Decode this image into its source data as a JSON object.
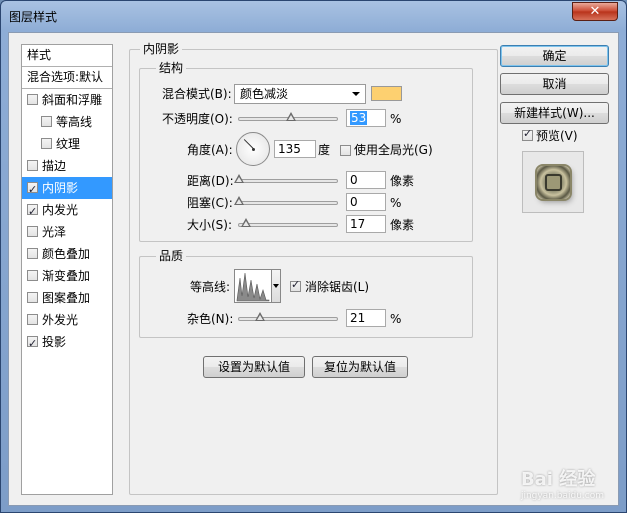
{
  "window": {
    "title": "图层样式",
    "close_glyph": "✕"
  },
  "sidebar": {
    "header": "样式",
    "blend_options": "混合选项:默认",
    "items": [
      {
        "label": "斜面和浮雕",
        "checked": false,
        "sub": false,
        "selected": false
      },
      {
        "label": "等高线",
        "checked": false,
        "sub": true,
        "selected": false
      },
      {
        "label": "纹理",
        "checked": false,
        "sub": true,
        "selected": false
      },
      {
        "label": "描边",
        "checked": false,
        "sub": false,
        "selected": false
      },
      {
        "label": "内阴影",
        "checked": true,
        "sub": false,
        "selected": true
      },
      {
        "label": "内发光",
        "checked": true,
        "sub": false,
        "selected": false
      },
      {
        "label": "光泽",
        "checked": false,
        "sub": false,
        "selected": false
      },
      {
        "label": "颜色叠加",
        "checked": false,
        "sub": false,
        "selected": false
      },
      {
        "label": "渐变叠加",
        "checked": false,
        "sub": false,
        "selected": false
      },
      {
        "label": "图案叠加",
        "checked": false,
        "sub": false,
        "selected": false
      },
      {
        "label": "外发光",
        "checked": false,
        "sub": false,
        "selected": false
      },
      {
        "label": "投影",
        "checked": true,
        "sub": false,
        "selected": false
      }
    ]
  },
  "panel": {
    "title": "内阴影",
    "structure": {
      "title": "结构",
      "blend_mode_label": "混合模式(B):",
      "blend_mode_value": "颜色减淡",
      "swatch_color": "#fdd070",
      "opacity_label": "不透明度(O):",
      "opacity_value": "53",
      "opacity_unit": "%",
      "opacity_fraction": 0.53,
      "angle_label": "角度(A):",
      "angle_value": "135",
      "angle_unit": "度",
      "global_light_label": "使用全局光(G)",
      "global_light_checked": false,
      "distance_label": "距离(D):",
      "distance_value": "0",
      "distance_unit": "像素",
      "distance_fraction": 0,
      "choke_label": "阻塞(C):",
      "choke_value": "0",
      "choke_unit": "%",
      "choke_fraction": 0,
      "size_label": "大小(S):",
      "size_value": "17",
      "size_unit": "像素",
      "size_fraction": 0.07
    },
    "quality": {
      "title": "品质",
      "contour_label": "等高线:",
      "antialias_label": "消除锯齿(L)",
      "antialias_checked": true,
      "noise_label": "杂色(N):",
      "noise_value": "21",
      "noise_unit": "%",
      "noise_fraction": 0.21
    },
    "make_default": "设置为默认值",
    "reset_default": "复位为默认值"
  },
  "actions": {
    "ok": "确定",
    "cancel": "取消",
    "new_style": "新建样式(W)...",
    "preview_label": "预览(V)",
    "preview_checked": true
  },
  "watermark": {
    "text": "Bai 经验",
    "sub": "jingyan.baidu.com"
  }
}
